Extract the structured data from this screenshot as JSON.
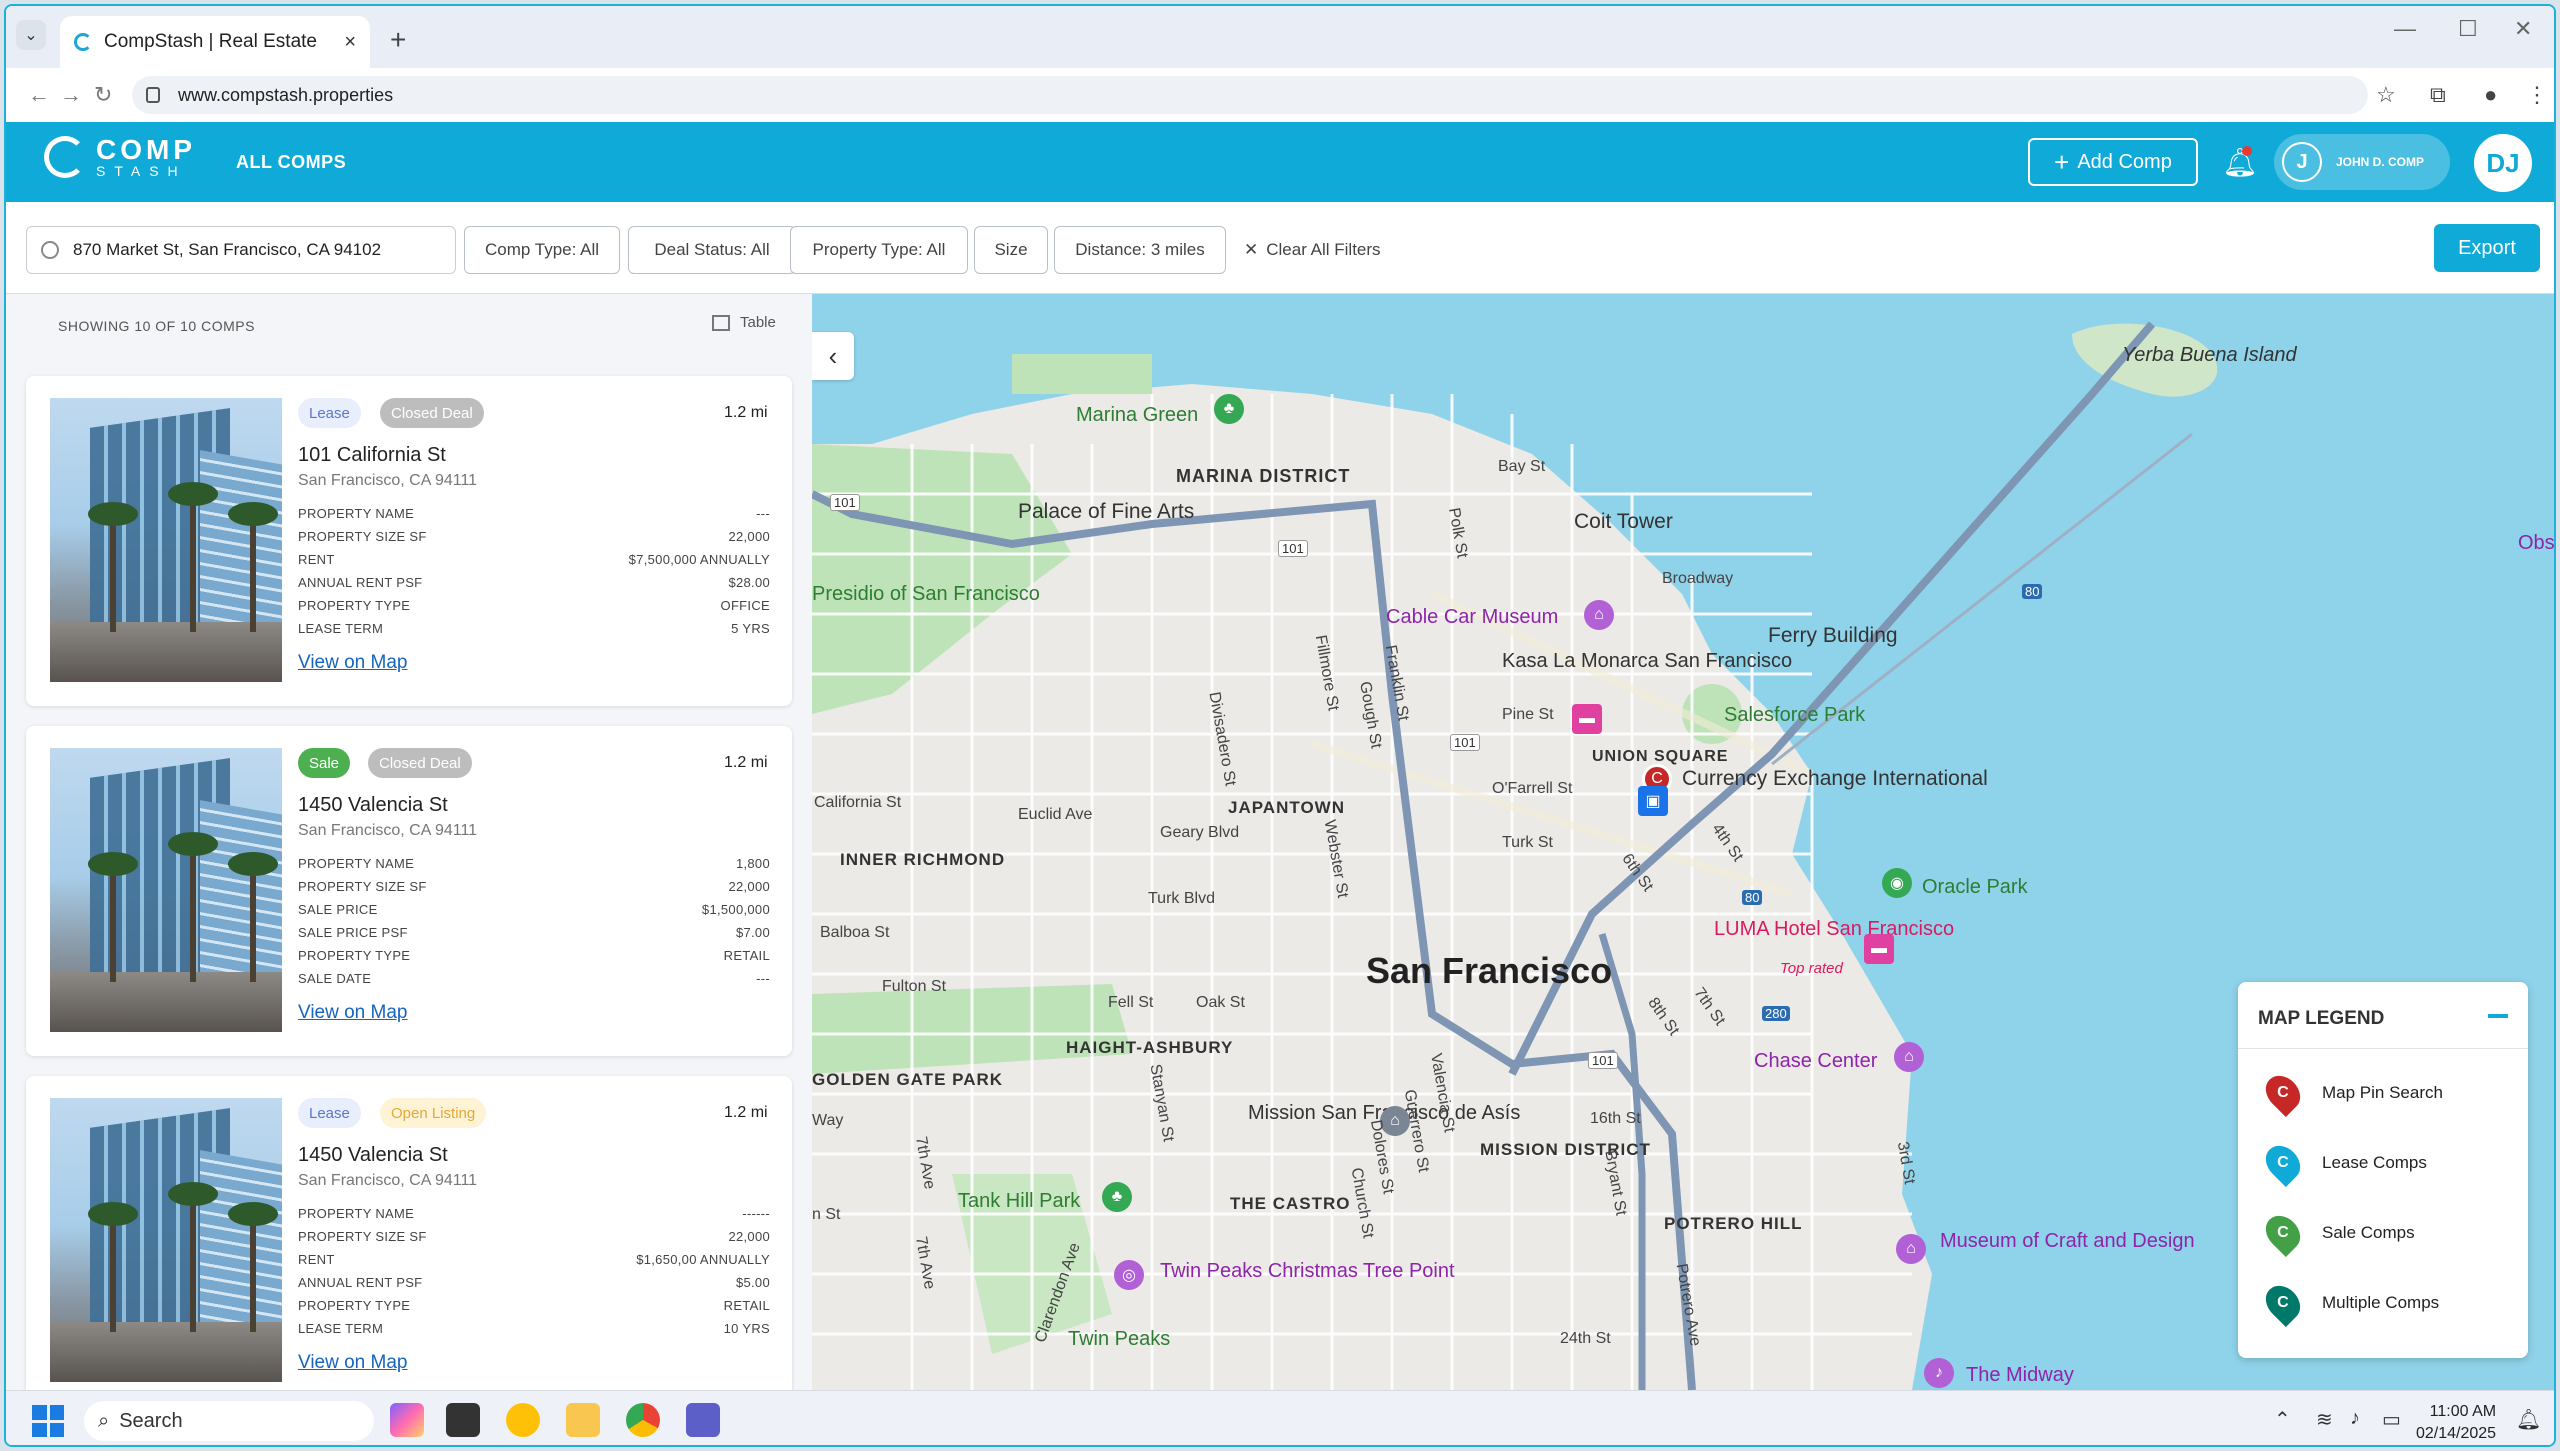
{
  "browser": {
    "tab_title": "CompStash | Real Estate",
    "url": "www.compstash.properties"
  },
  "header": {
    "logo_line1": "COMP",
    "logo_line2": "STASH",
    "nav_all_comps": "ALL COMPS",
    "add_comp_label": "Add Comp",
    "user_initial": "J",
    "user_name": "JOHN D. COMP",
    "avatar_initials": "DJ",
    "brand_color": "#0faad7"
  },
  "filters": {
    "search_value": "870 Market St, San Francisco, CA 94102",
    "comp_type": "Comp Type: All",
    "deal_status": "Deal Status: All",
    "property_type": "Property Type: All",
    "size": "Size",
    "distance": "Distance: 3 miles",
    "clear_all": "Clear All Filters",
    "export": "Export"
  },
  "list": {
    "showing": "SHOWING 10 OF 10 COMPS",
    "table_toggle": "Table",
    "cards": [
      {
        "type_badge": "Lease",
        "status_badge": "Closed Deal",
        "distance": "1.2 mi",
        "address": "101 California St",
        "city": "San Francisco, CA 94111",
        "props": [
          {
            "label": "PROPERTY NAME",
            "value": "---"
          },
          {
            "label": "PROPERTY SIZE SF",
            "value": "22,000"
          },
          {
            "label": "RENT",
            "value": "$7,500,000 ANNUALLY"
          },
          {
            "label": "ANNUAL RENT PSF",
            "value": "$28.00"
          },
          {
            "label": "PROPERTY TYPE",
            "value": "OFFICE"
          },
          {
            "label": "LEASE TERM",
            "value": "5 YRS"
          }
        ],
        "view_on_map": "View on Map"
      },
      {
        "type_badge": "Sale",
        "status_badge": "Closed Deal",
        "distance": "1.2 mi",
        "address": "1450 Valencia St",
        "city": "San Francisco, CA 94111",
        "props": [
          {
            "label": "PROPERTY NAME",
            "value": "1,800"
          },
          {
            "label": "PROPERTY SIZE SF",
            "value": "22,000"
          },
          {
            "label": "SALE PRICE",
            "value": "$1,500,000"
          },
          {
            "label": "SALE PRICE PSF",
            "value": "$7.00"
          },
          {
            "label": "PROPERTY TYPE",
            "value": "RETAIL"
          },
          {
            "label": "SALE DATE",
            "value": "---"
          }
        ],
        "view_on_map": "View on Map"
      },
      {
        "type_badge": "Lease",
        "status_badge": "Open Listing",
        "distance": "1.2 mi",
        "address": "1450 Valencia St",
        "city": "San Francisco, CA 94111",
        "props": [
          {
            "label": "PROPERTY NAME",
            "value": "------"
          },
          {
            "label": "PROPERTY SIZE SF",
            "value": "22,000"
          },
          {
            "label": "RENT",
            "value": "$1,650,00 ANNUALLY"
          },
          {
            "label": "ANNUAL RENT PSF",
            "value": "$5.00"
          },
          {
            "label": "PROPERTY TYPE",
            "value": "RETAIL"
          },
          {
            "label": "LEASE TERM",
            "value": "10 YRS"
          }
        ],
        "view_on_map": "View on Map"
      }
    ]
  },
  "map": {
    "labels": {
      "yerba": "Yerba Buena Island",
      "marina_green": "Marina Green",
      "marina_district": "MARINA DISTRICT",
      "palace": "Palace of Fine Arts",
      "bay_st": "Bay St",
      "coit": "Coit Tower",
      "polk": "Polk St",
      "broadway": "Broadway",
      "ferry": "Ferry Building",
      "presidio": "Presidio of San Francisco",
      "cable_car": "Cable Car Museum",
      "kasa": "Kasa La Monarca San Francisco",
      "pine": "Pine St",
      "salesforce": "Salesforce Park",
      "union_square": "UNION SQUARE",
      "currency": "Currency Exchange International",
      "california_st": "California St",
      "euclid": "Euclid Ave",
      "japantown": "JAPANTOWN",
      "ofarrell": "O'Farrell St",
      "inner_richmond": "INNER RICHMOND",
      "geary": "Geary Blvd",
      "turk_st": "Turk St",
      "oracle": "Oracle Park",
      "turk_blvd": "Turk Blvd",
      "balboa": "Balboa St",
      "luma": "LUMA Hotel San Francisco",
      "top_rated": "Top rated",
      "san_francisco": "San Francisco",
      "fulton": "Fulton St",
      "fell": "Fell St",
      "oak": "Oak St",
      "haight": "HAIGHT-ASHBURY",
      "golden_gate": "GOLDEN GATE PARK",
      "chase": "Chase Center",
      "mission_san": "Mission San Francisco de Asís",
      "sixteenth": "16th St",
      "mission_district": "MISSION DISTRICT",
      "tank_hill": "Tank Hill Park",
      "castro": "THE CASTRO",
      "potrero": "POTRERO HILL",
      "museum_craft": "Museum of Craft and Design",
      "twin_peaks_tree": "Twin Peaks Christmas Tree Point",
      "twin_peaks": "Twin Peaks",
      "twentyfourth": "24th St",
      "midway": "The Midway",
      "fillmore": "Fillmore St",
      "divisadero": "Divisadero St",
      "franklin": "Franklin St",
      "gough": "Gough St",
      "webster": "Webster St",
      "valencia": "Valencia St",
      "guerrero": "Guerrero St",
      "dolores": "Dolores St",
      "church": "Church St",
      "stanyan": "Stanyan St",
      "seventh_ave": "7th Ave",
      "clarendon": "Clarendon Ave",
      "bryant": "Bryant St",
      "potrero_ave": "Potrero Ave",
      "third": "3rd St",
      "sixth": "6th St",
      "fourth": "4th St",
      "seventh_st": "7th St",
      "eighth": "8th St",
      "hwy101": "101",
      "hwy80": "80",
      "hwy280": "280",
      "obs": "Obse",
      "way": "Way",
      "n_st": "n St"
    },
    "legend": {
      "title": "MAP LEGEND",
      "items": [
        {
          "label": "Map Pin Search",
          "color": "#c62828"
        },
        {
          "label": "Lease Comps",
          "color": "#0faad7"
        },
        {
          "label": "Sale Comps",
          "color": "#43a047"
        },
        {
          "label": "Multiple Comps",
          "color": "#00796b"
        }
      ]
    }
  },
  "taskbar": {
    "search": "Search",
    "time": "11:00 AM",
    "date": "02/14/2025"
  }
}
